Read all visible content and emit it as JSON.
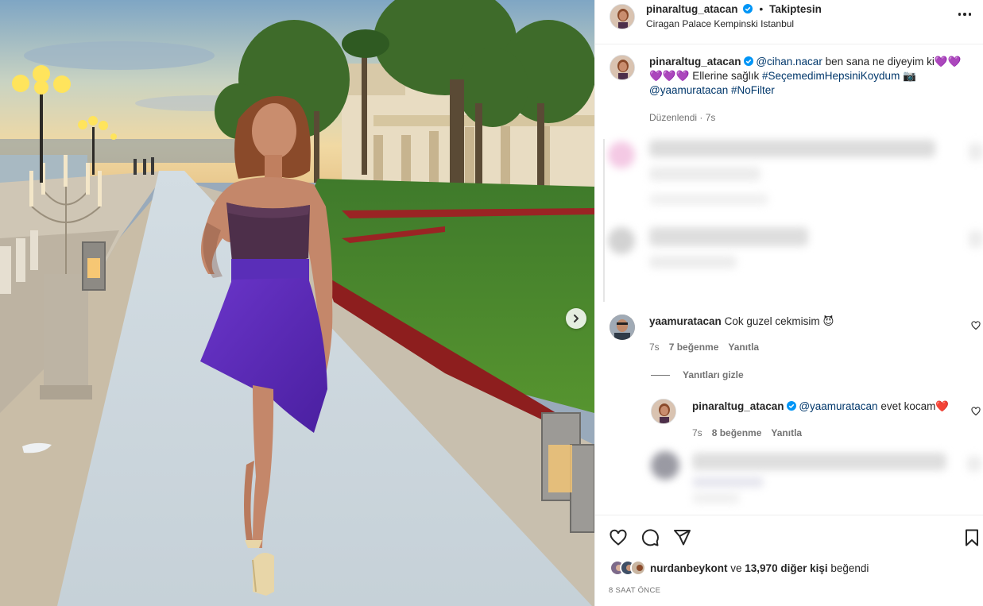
{
  "post": {
    "author": "pinaraltug_atacan",
    "follow_status": "Takiptesin",
    "separator": "•",
    "location": "Ciragan Palace Kempinski Istanbul"
  },
  "caption": {
    "author": "pinaraltug_atacan",
    "mention": "@cihan.nacar",
    "text1": " ben sana ne diyeyim ki",
    "hearts1": "💜💜",
    "hearts2": "💜💜💜",
    "text2": " Ellerine sağlık ",
    "hashtag1": "#SeçemedimHepsiniKoydum",
    "camera": " 📷",
    "mention2": "@yaamuratacan",
    "hashtag2": " #NoFilter",
    "time": "Düzenlendi · 7s"
  },
  "comments": [
    {
      "username": "yaamuratacan",
      "text": "Cok guzel cekmisim ",
      "emoji": "😈",
      "time": "7s",
      "likes": "7 beğenme",
      "reply": "Yanıtla"
    }
  ],
  "hide_replies": "Yanıtları gizle",
  "reply": {
    "username": "pinaraltug_atacan",
    "mention": "@yaamuratacan",
    "text": " evet kocam",
    "emoji": "❤️",
    "time": "7s",
    "likes": "8 beğenme",
    "reply": "Yanıtla"
  },
  "likes": {
    "first_liker": "nurdanbeykont",
    "connector": " ve ",
    "count": "13,970 diğer kişi",
    "suffix": " beğendi"
  },
  "date": "8 SAAT ÖNCE",
  "colors": {
    "text": "#262626",
    "muted": "#737373",
    "link": "#00376b",
    "verified": "#0095f6",
    "dress": "#5b2bb5"
  }
}
